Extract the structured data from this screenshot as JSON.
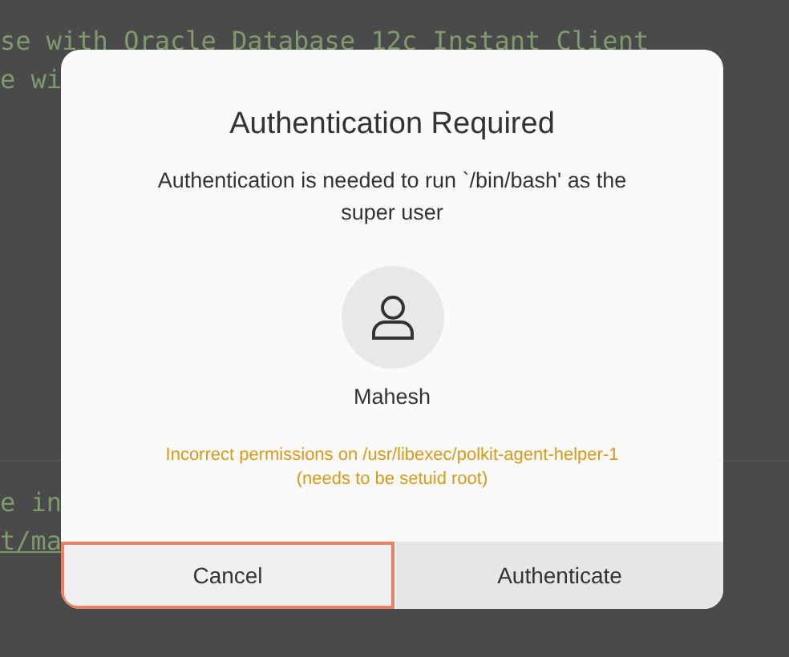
{
  "terminal": {
    "lines_top": [
      "se with Oracle Database 12c Instant Client",
      "e wi"
    ],
    "lines_bottom": [
      {
        "text": "e in",
        "underlined": false
      },
      {
        "text": "t/ma",
        "underlined": true
      }
    ]
  },
  "dialog": {
    "title": "Authentication Required",
    "message": "Authentication is needed to run `/bin/bash' as the super user",
    "user": "Mahesh",
    "error": "Incorrect permissions on /usr/libexec/polkit-agent-helper-1 (needs to be setuid root)",
    "buttons": [
      {
        "label": "Cancel",
        "selected": true
      },
      {
        "label": "Authenticate",
        "selected": false
      }
    ]
  }
}
